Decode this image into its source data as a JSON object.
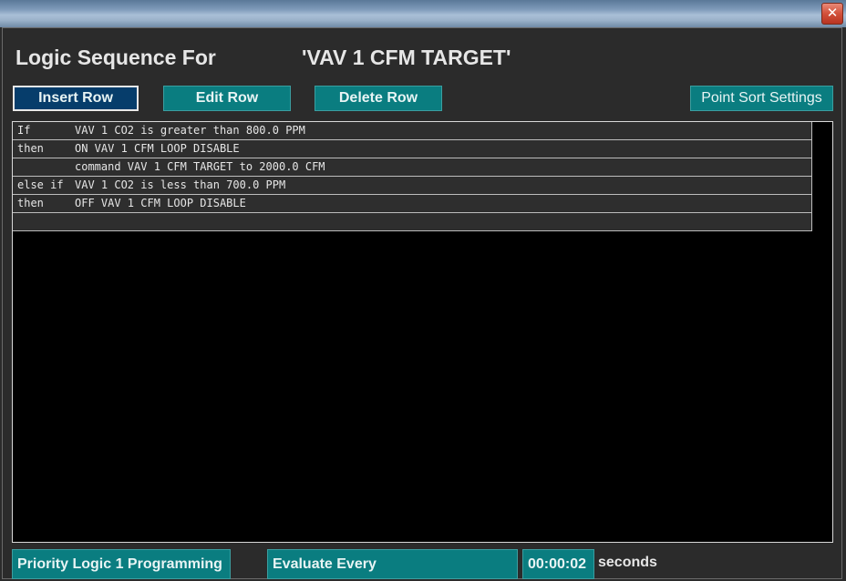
{
  "window": {
    "close_symbol": "✕"
  },
  "header": {
    "title_label": "Logic Sequence For",
    "point_name": "'VAV 1 CFM TARGET'"
  },
  "toolbar": {
    "insert_row": "Insert Row",
    "edit_row": "Edit Row",
    "delete_row": "Delete Row",
    "point_sort_settings": "Point Sort Settings"
  },
  "logic_rows": [
    {
      "keyword": "If",
      "text": "VAV 1 CO2 is greater than 800.0 PPM"
    },
    {
      "keyword": "then",
      "text": "ON VAV 1 CFM LOOP DISABLE"
    },
    {
      "keyword": "",
      "text": "command VAV 1 CFM TARGET to 2000.0 CFM"
    },
    {
      "keyword": "else if",
      "text": "VAV 1 CO2 is less than 700.0 PPM"
    },
    {
      "keyword": "then",
      "text": "OFF VAV 1 CFM LOOP DISABLE"
    },
    {
      "keyword": "",
      "text": ""
    }
  ],
  "footer": {
    "program_name": "Priority Logic 1 Programming",
    "evaluate_label": "Evaluate Every",
    "interval": "00:00:02",
    "unit": "seconds"
  },
  "colors": {
    "button_teal": "#0a7d80",
    "button_active": "#063d6b",
    "background": "#2b2b2b",
    "grid_background": "#000000"
  }
}
